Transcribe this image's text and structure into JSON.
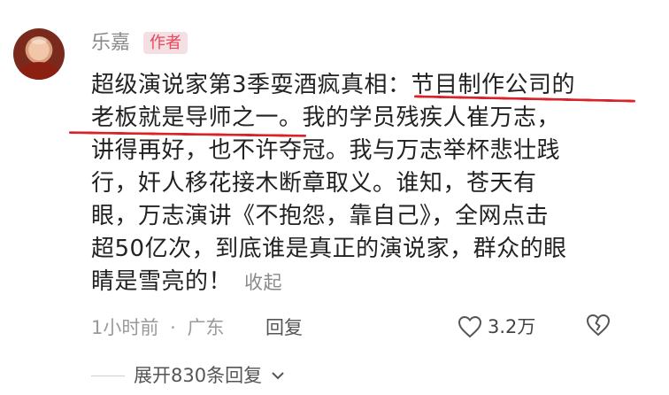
{
  "comment": {
    "username": "乐嘉",
    "author_badge": "作者",
    "lines": [
      "超级演说家第3季耍酒疯真相：节目制作公司的",
      "老板就是导师之一。我的学员残疾人崔万志，",
      "讲得再好，也不许夺冠。我与万志举杯悲壮践",
      "行，奸人移花接木断章取义。谁知，苍天有",
      "眼，万志演讲《不抱怨，靠自己》，全网点击",
      "超50亿次，到底谁是真正的演说家，群众的眼",
      "睛是雪亮的！"
    ],
    "collapse_label": "收起",
    "time": "1小时前",
    "separator": "·",
    "location": "广东",
    "reply_label": "回复",
    "like_count": "3.2万",
    "expand_replies": "展开830条回复"
  },
  "colors": {
    "underline": "#d9232a",
    "badge_text": "#e8465a",
    "badge_bg": "#f4dfe3"
  }
}
